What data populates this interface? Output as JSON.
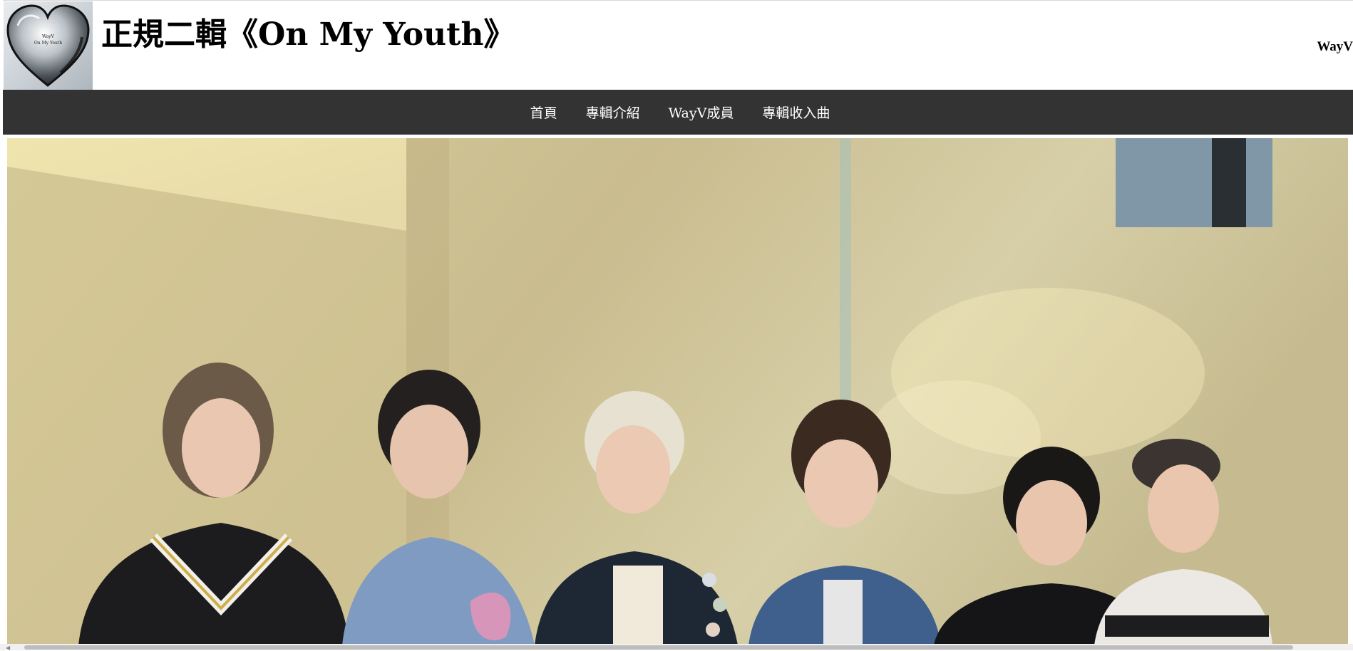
{
  "header": {
    "title": "正規二輯《On My Youth》",
    "brand": "WayV",
    "logo_icon": "heart-logo-icon",
    "logo_text_line1": "WayV",
    "logo_text_line2": "On My Youth"
  },
  "nav": {
    "items": [
      {
        "label": "首頁"
      },
      {
        "label": "專輯介紹"
      },
      {
        "label": "WayV成員"
      },
      {
        "label": "專輯收入曲"
      }
    ]
  },
  "colors": {
    "nav_bg": "#333333",
    "header_bg": "#ffffff",
    "nav_text": "#ffffff"
  }
}
